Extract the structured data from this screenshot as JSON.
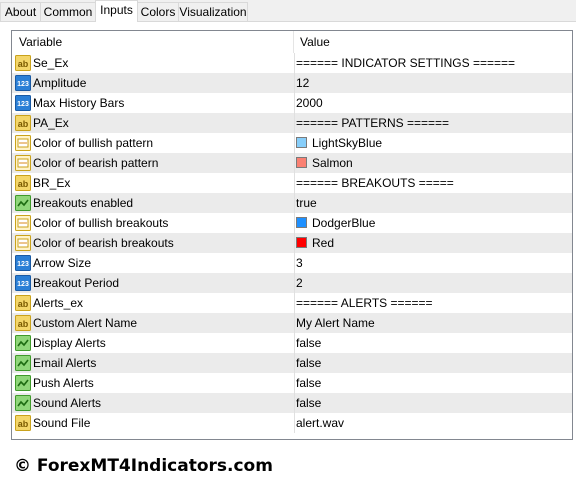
{
  "tabs": [
    "About",
    "Common",
    "Inputs",
    "Colors",
    "Visualization"
  ],
  "active_tab": "Inputs",
  "table": {
    "header": {
      "variable": "Variable",
      "value": "Value"
    },
    "rows": [
      {
        "type": "string",
        "icon": "string-ab-icon",
        "name": "Se_Ex",
        "value": "====== INDICATOR SETTINGS ======"
      },
      {
        "type": "int",
        "icon": "integer-123-icon",
        "name": "Amplitude",
        "value": "12"
      },
      {
        "type": "int",
        "icon": "integer-123-icon",
        "name": "Max History Bars",
        "value": "2000"
      },
      {
        "type": "string",
        "icon": "string-ab-icon",
        "name": "PA_Ex",
        "value": "====== PATTERNS ======"
      },
      {
        "type": "color",
        "icon": "color-icon",
        "name": "Color of bullish pattern",
        "value": "LightSkyBlue",
        "swatch": "#87cefa"
      },
      {
        "type": "color",
        "icon": "color-icon",
        "name": "Color of bearish pattern",
        "value": "Salmon",
        "swatch": "#fa8072"
      },
      {
        "type": "string",
        "icon": "string-ab-icon",
        "name": "BR_Ex",
        "value": "====== BREAKOUTS ====="
      },
      {
        "type": "bool",
        "icon": "boolean-icon",
        "name": "Breakouts enabled",
        "value": "true"
      },
      {
        "type": "color",
        "icon": "color-icon",
        "name": "Color of bullish breakouts",
        "value": "DodgerBlue",
        "swatch": "#1e90ff"
      },
      {
        "type": "color",
        "icon": "color-icon",
        "name": "Color of bearish breakouts",
        "value": "Red",
        "swatch": "#ff0000"
      },
      {
        "type": "int",
        "icon": "integer-123-icon",
        "name": "Arrow Size",
        "value": "3"
      },
      {
        "type": "int",
        "icon": "integer-123-icon",
        "name": "Breakout Period",
        "value": "2"
      },
      {
        "type": "string",
        "icon": "string-ab-icon",
        "name": "Alerts_ex",
        "value": "====== ALERTS ======"
      },
      {
        "type": "string",
        "icon": "string-ab-icon",
        "name": "Custom Alert Name",
        "value": "My Alert Name"
      },
      {
        "type": "bool",
        "icon": "boolean-icon",
        "name": "Display Alerts",
        "value": "false"
      },
      {
        "type": "bool",
        "icon": "boolean-icon",
        "name": "Email Alerts",
        "value": "false"
      },
      {
        "type": "bool",
        "icon": "boolean-icon",
        "name": "Push Alerts",
        "value": "false"
      },
      {
        "type": "bool",
        "icon": "boolean-icon",
        "name": "Sound Alerts",
        "value": "false"
      },
      {
        "type": "string",
        "icon": "string-ab-icon",
        "name": "Sound File",
        "value": "alert.wav"
      }
    ]
  },
  "footer": {
    "watermark": "© ForexMT4Indicators.com"
  }
}
